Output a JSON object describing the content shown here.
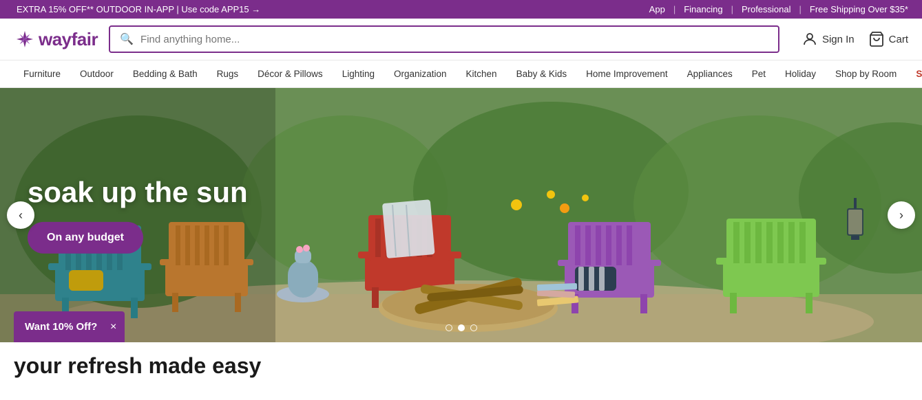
{
  "banner": {
    "left_text": "EXTRA 15% OFF** OUTDOOR IN-APP | Use code APP15 →",
    "right_links": [
      "App",
      "Financing",
      "Professional",
      "Free Shipping Over $35*"
    ]
  },
  "header": {
    "logo_text": "wayfair",
    "search_placeholder": "Find anything home...",
    "sign_in_label": "Sign In",
    "cart_label": "Cart"
  },
  "nav": {
    "items": [
      {
        "label": "Furniture",
        "sale": false
      },
      {
        "label": "Outdoor",
        "sale": false
      },
      {
        "label": "Bedding & Bath",
        "sale": false
      },
      {
        "label": "Rugs",
        "sale": false
      },
      {
        "label": "Décor & Pillows",
        "sale": false
      },
      {
        "label": "Lighting",
        "sale": false
      },
      {
        "label": "Organization",
        "sale": false
      },
      {
        "label": "Kitchen",
        "sale": false
      },
      {
        "label": "Baby & Kids",
        "sale": false
      },
      {
        "label": "Home Improvement",
        "sale": false
      },
      {
        "label": "Appliances",
        "sale": false
      },
      {
        "label": "Pet",
        "sale": false
      },
      {
        "label": "Holiday",
        "sale": false
      },
      {
        "label": "Shop by Room",
        "sale": false
      },
      {
        "label": "Sale",
        "sale": true
      }
    ]
  },
  "hero": {
    "headline": "soak up the sun",
    "cta_label": "On any budget",
    "dots": [
      {
        "active": false
      },
      {
        "active": true
      },
      {
        "active": false
      }
    ]
  },
  "toast": {
    "text": "Want 10% Off?",
    "close_label": "×"
  },
  "below_fold": {
    "text": "your refresh made easy"
  },
  "colors": {
    "brand_purple": "#7b2d8b",
    "sale_red": "#c0392b",
    "teal_chair": "#3ba3b0",
    "orange_chair": "#e8943a",
    "red_chair": "#c0392b",
    "purple_chair": "#9b59b6",
    "green_chair": "#7ec850"
  }
}
